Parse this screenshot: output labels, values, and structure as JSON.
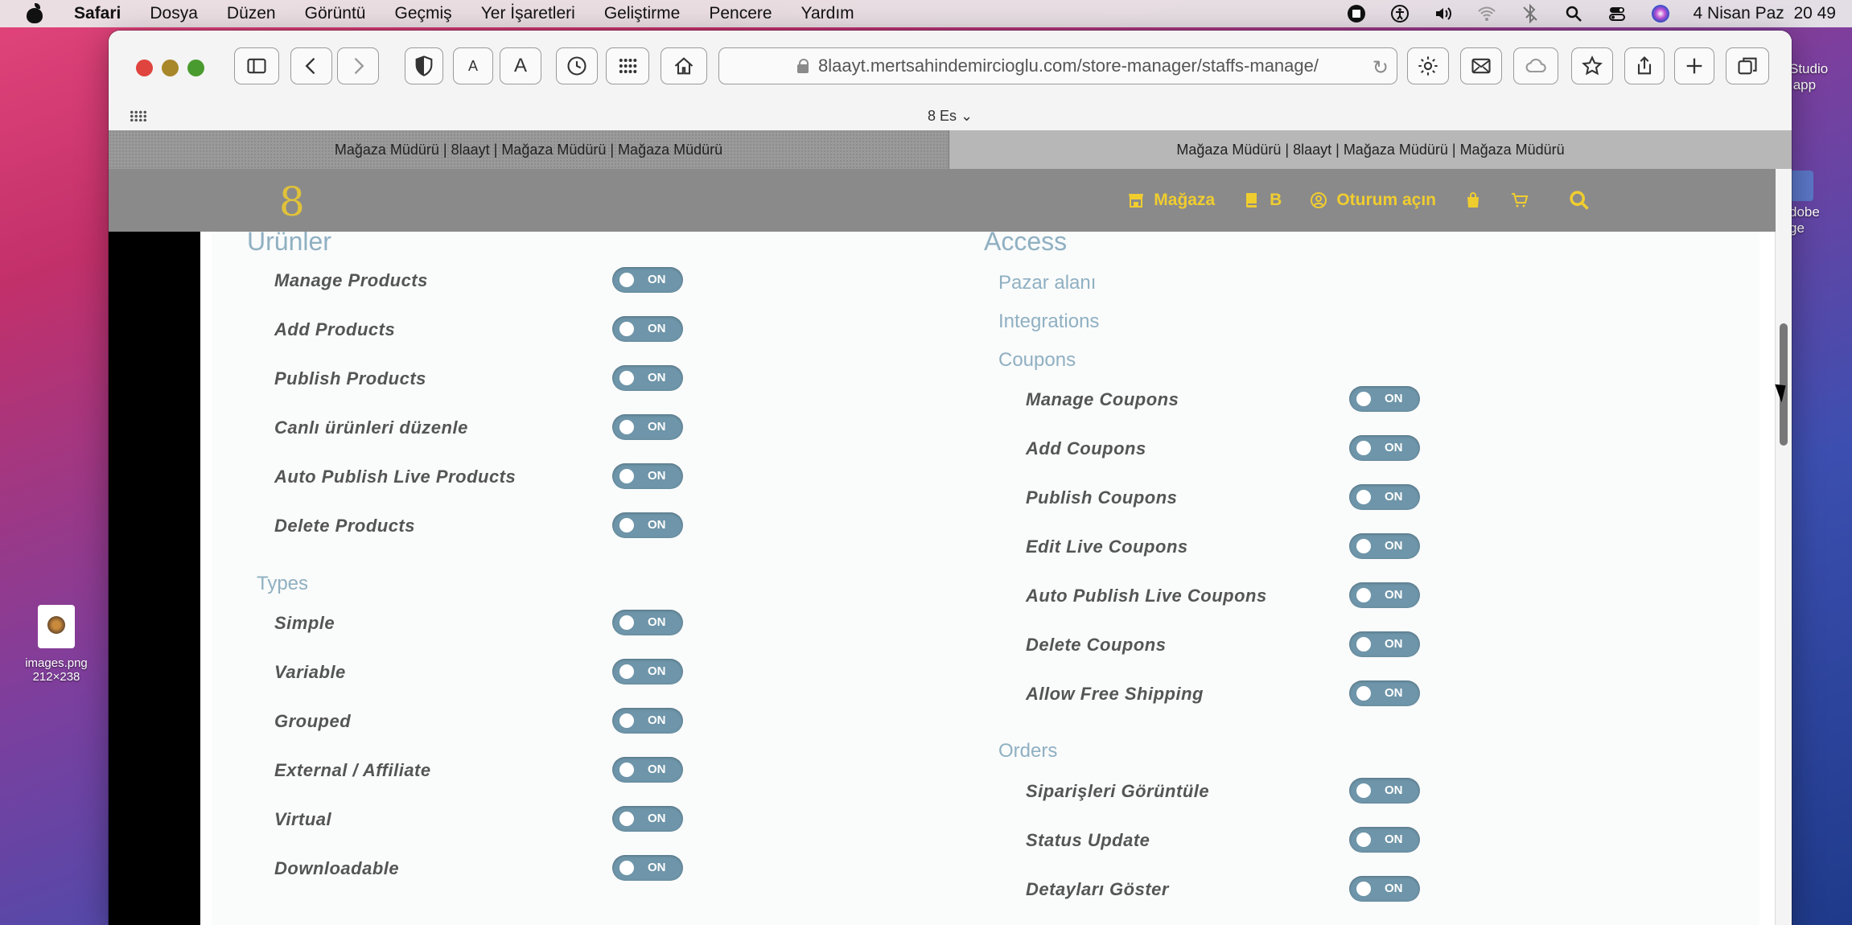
{
  "menubar": {
    "app": "Safari",
    "items": [
      "Dosya",
      "Düzen",
      "Görüntü",
      "Geçmiş",
      "Yer İşaretleri",
      "Geliştirme",
      "Pencere",
      "Yardım"
    ],
    "datetime": "4 Nisan Paz  20 49"
  },
  "desktop": {
    "file_name": "images.png",
    "file_dims": "212×238",
    "right_label_1": "Studio",
    "right_label_1b": ".app",
    "right_label_2": "dobe",
    "right_label_2b": "ge"
  },
  "browser": {
    "url": "8laayt.mertsahindemircioglu.com/store-manager/staffs-manage/",
    "font_small": "A",
    "font_large": "A",
    "favorites_label": "8 Es ⌄",
    "tabs": [
      "Mağaza Müdürü | 8laayt | Mağaza Müdürü | Mağaza Müdürü",
      "Mağaza Müdürü | 8laayt | Mağaza Müdürü | Mağaza Müdürü"
    ]
  },
  "site": {
    "logo": "8",
    "nav": {
      "store": "Mağaza",
      "book": "B",
      "login": "Oturum açın"
    },
    "left": {
      "title": "Ürünler",
      "product_perms": [
        "Manage Products",
        "Add Products",
        "Publish Products",
        "Canlı ürünleri düzenle",
        "Auto Publish Live Products",
        "Delete Products"
      ],
      "types_label": "Types",
      "type_perms": [
        "Simple",
        "Variable",
        "Grouped",
        "External / Affiliate",
        "Virtual",
        "Downloadable"
      ]
    },
    "right": {
      "title": "Access",
      "links": [
        "Pazar alanı",
        "Integrations"
      ],
      "coupons_label": "Coupons",
      "coupon_perms": [
        "Manage Coupons",
        "Add Coupons",
        "Publish Coupons",
        "Edit Live Coupons",
        "Auto Publish Live Coupons",
        "Delete Coupons",
        "Allow Free Shipping"
      ],
      "orders_label": "Orders",
      "order_perms": [
        "Siparişleri Görüntüle",
        "Status Update",
        "Detayları Göster"
      ]
    },
    "toggle_label": "ON"
  },
  "colors": {
    "toggle_on": "#6e95a9",
    "section_blue": "#8fb0c2",
    "nav_yellow": "#f0cd2f",
    "header_gray": "#8a8a8a"
  }
}
